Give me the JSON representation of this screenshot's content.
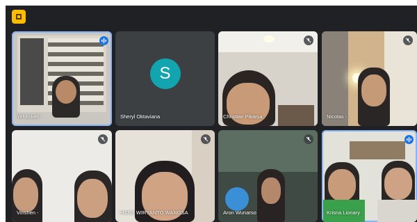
{
  "colors": {
    "background": "#202124",
    "tile": "#3c4043",
    "avatar": "#12a4af",
    "active_border": "#8ab4f8",
    "speaking": "#1a73e8",
    "badge": "#fbbc04"
  },
  "participants": [
    {
      "name": "Yehezkiel -",
      "state": "speaking"
    },
    {
      "name": "Sheryl Oktaviana",
      "avatar_letter": "S",
      "state": "camera-off"
    },
    {
      "name": "Christian Pikarsa",
      "state": "muted"
    },
    {
      "name": "Nicolas -",
      "state": "muted"
    },
    {
      "name": "Vinshen -",
      "state": "muted"
    },
    {
      "name": "HANS WIRYANTO WANGSA",
      "state": "muted"
    },
    {
      "name": "Aron Wunarso",
      "state": "muted"
    },
    {
      "name": "Krisna Lionary",
      "state": "speaking"
    }
  ],
  "icons": {
    "badge": "presentation-icon",
    "muted": "mic-off-icon",
    "speaking": "audio-wave-icon"
  }
}
